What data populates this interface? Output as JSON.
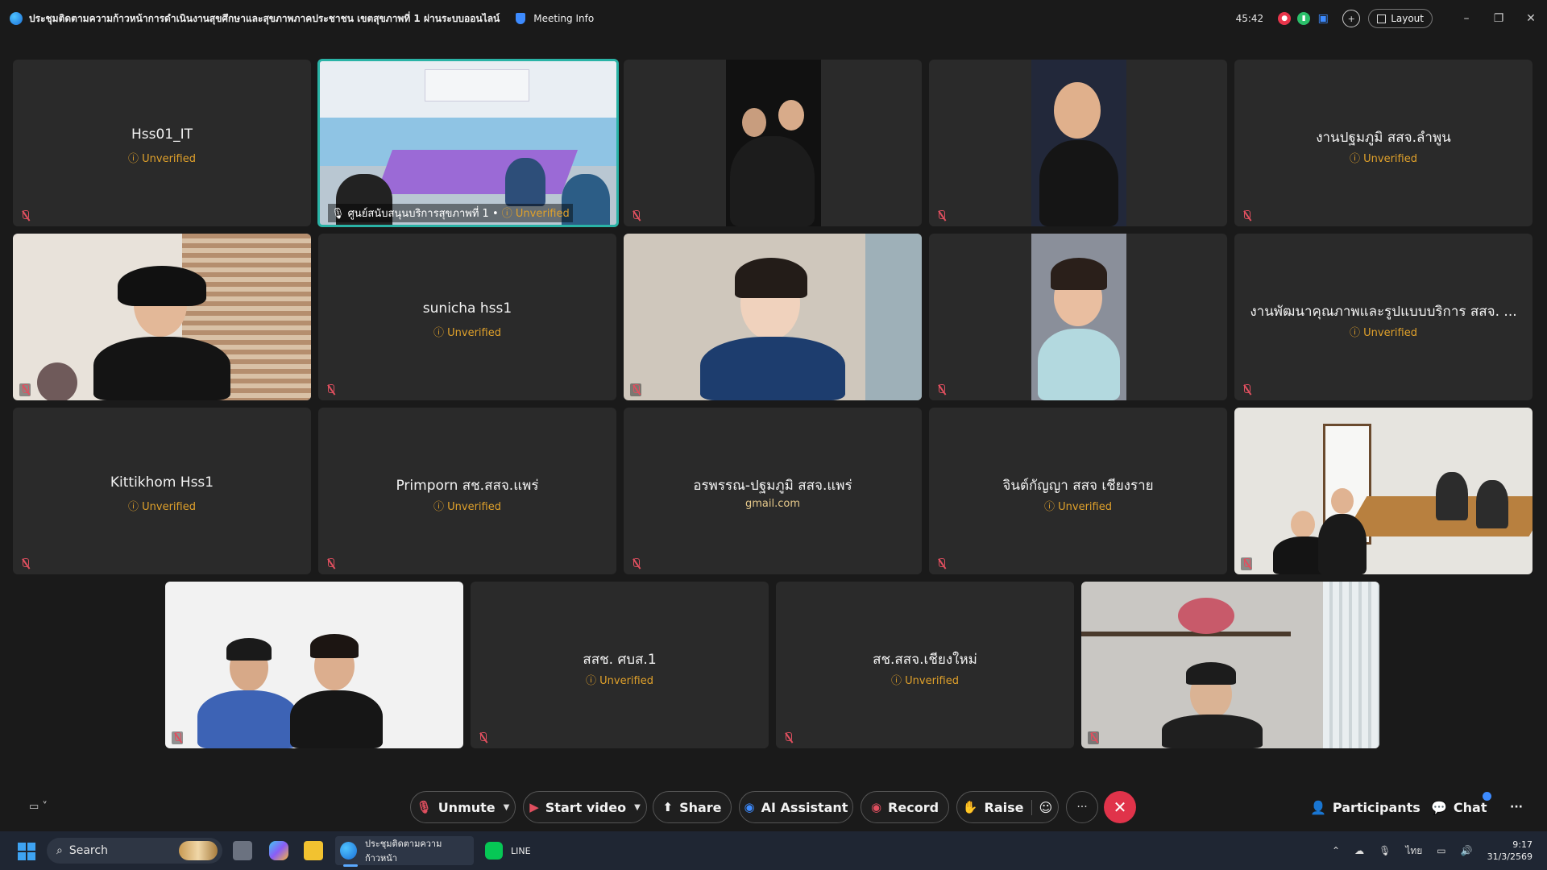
{
  "titlebar": {
    "title": "ประชุมติดตามความก้าวหน้าการดำเนินงานสุขศึกษาและสุขภาพภาคประชาชน เขตสุขภาพที่ 1 ผ่านระบบออนไลน์",
    "meeting_info": "Meeting Info",
    "timer": "45:42",
    "layout": "Layout"
  },
  "tiles": {
    "t1": {
      "name": "Hss01_IT",
      "status": "Unverified"
    },
    "t2": {
      "name": "ศูนย์สนับสนุนบริการสุขภาพที่ 1 •",
      "status": "Unverified"
    },
    "t5": {
      "name": "งานปฐมภูมิ สสจ.ลำพูน",
      "status": "Unverified"
    },
    "t7": {
      "name": "sunicha hss1",
      "status": "Unverified"
    },
    "t10": {
      "name": "งานพัฒนาคุณภาพและรูปแบบบริการ สสจ. ...",
      "status": "Unverified"
    },
    "t11": {
      "name": "Kittikhom Hss1",
      "status": "Unverified"
    },
    "t12": {
      "name": "Primporn สช.สสจ.แพร่",
      "status": "Unverified"
    },
    "t13": {
      "name": "อรพรรณ-ปฐมภูมิ สสจ.แพร่",
      "status": "gmail.com"
    },
    "t14": {
      "name": "จินต์กัญญา สสจ เชียงราย",
      "status": "Unverified"
    },
    "t17": {
      "name": "สสช. ศบส.1",
      "status": "Unverified"
    },
    "t18": {
      "name": "สช.สสจ.เชียงใหม่",
      "status": "Unverified"
    }
  },
  "toolbar": {
    "unmute": "Unmute",
    "start_video": "Start video",
    "share": "Share",
    "ai_assistant": "AI Assistant",
    "record": "Record",
    "raise": "Raise",
    "participants": "Participants",
    "chat": "Chat"
  },
  "taskbar": {
    "search": "Search",
    "webex_app": "ประชุมติดตามความก้าวหน้า",
    "line_app": "LINE",
    "lang": "ไทย",
    "time": "9:17",
    "date": "31/3/2569"
  },
  "colors": {
    "unverified": "#e0a12b",
    "active_border": "#2ab3a6",
    "end_call": "#e0334a"
  }
}
